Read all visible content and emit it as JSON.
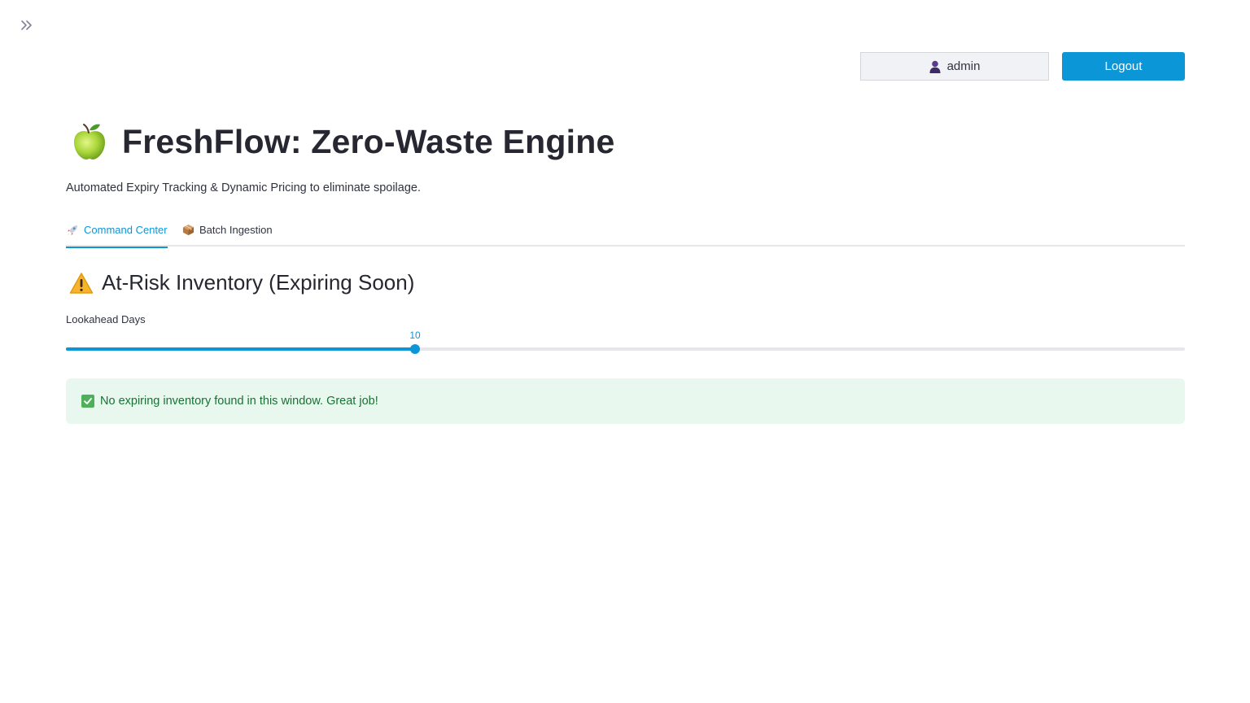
{
  "header": {
    "username": "admin",
    "logout_label": "Logout"
  },
  "main": {
    "title": "FreshFlow: Zero-Waste Engine",
    "subtitle": "Automated Expiry Tracking & Dynamic Pricing to eliminate spoilage.",
    "tabs": [
      {
        "label": "Command Center",
        "icon": "rocket-icon",
        "active": true
      },
      {
        "label": "Batch Ingestion",
        "icon": "package-icon",
        "active": false
      }
    ],
    "section": {
      "title": "At-Risk Inventory (Expiring Soon)",
      "icon": "warning-icon"
    },
    "slider": {
      "label": "Lookahead Days",
      "value": "10",
      "fraction": 0.312
    },
    "alert": {
      "message": "No expiring inventory found in this window. Great job!",
      "icon": "check-icon"
    }
  },
  "colors": {
    "accent": "#0b96d8",
    "success_bg": "#e8f8ee",
    "success_text": "#177233"
  }
}
